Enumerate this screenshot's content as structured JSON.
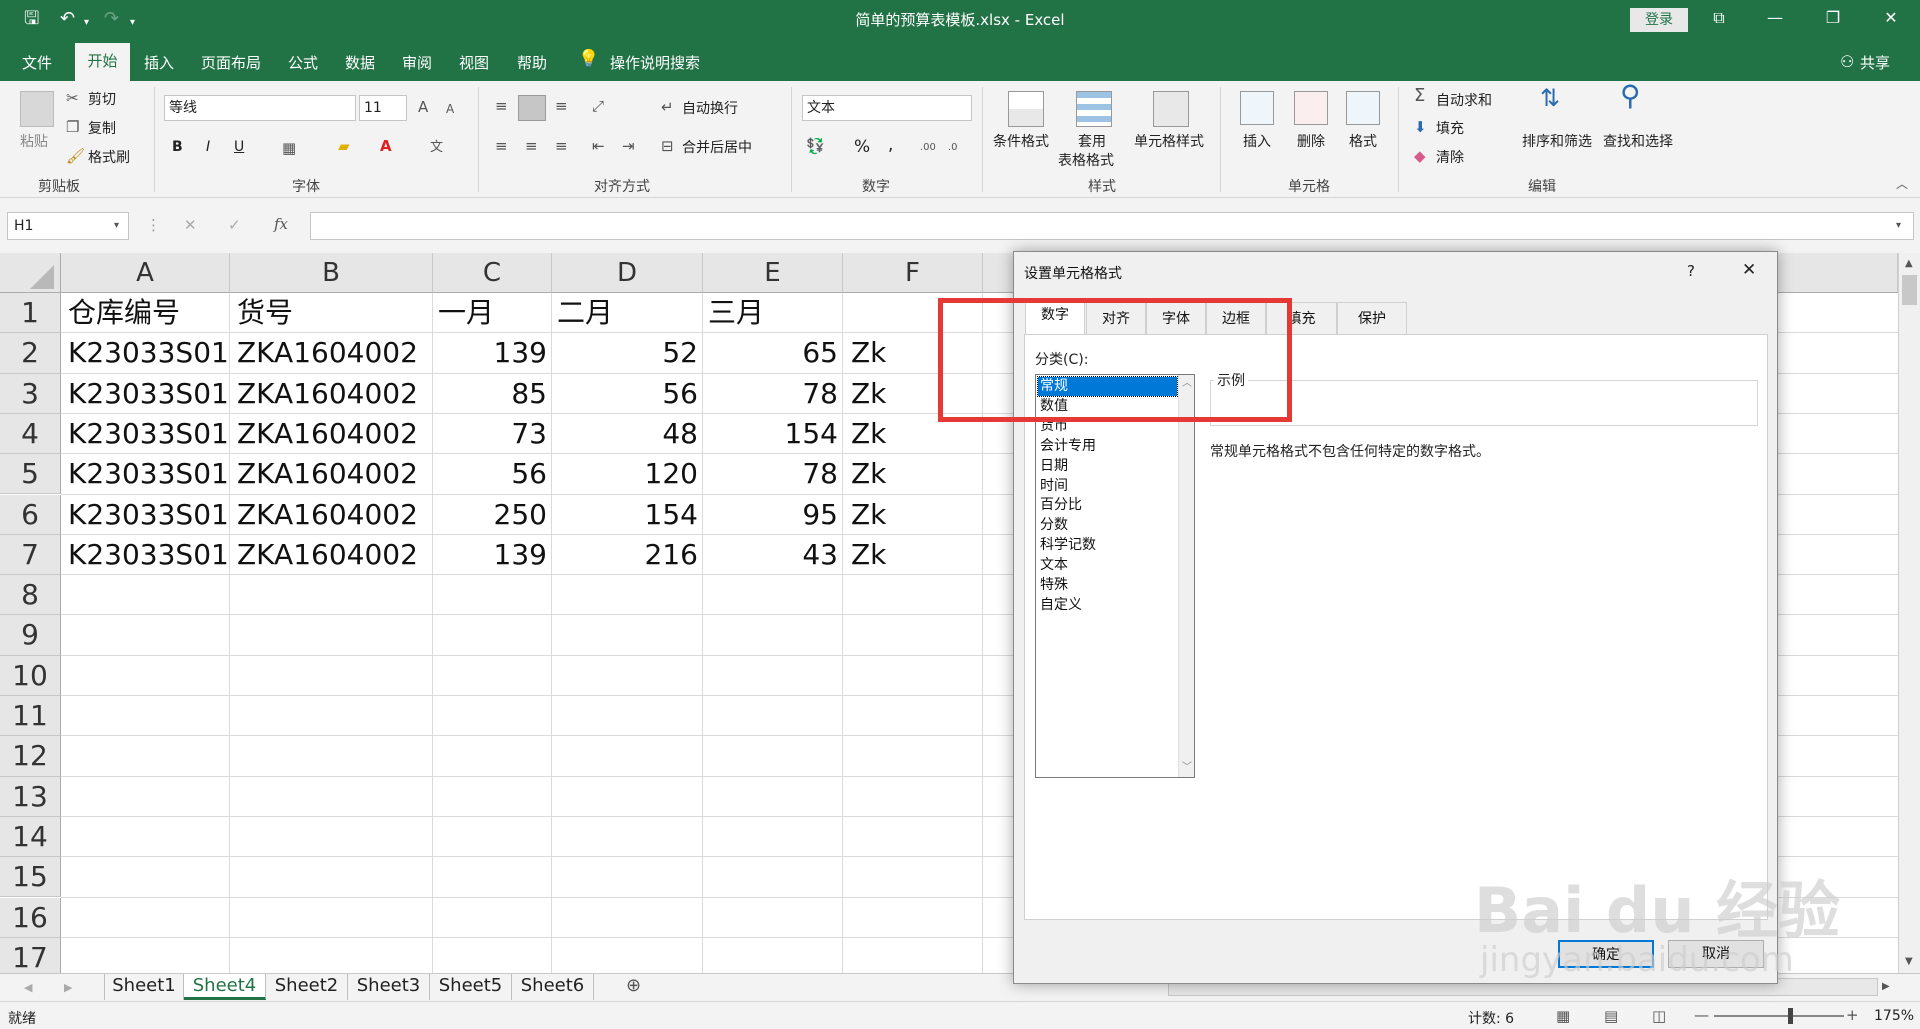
{
  "title_bar": {
    "doc_title": "简单的预算表模板.xlsx  -  Excel",
    "login": "登录"
  },
  "menu": {
    "tabs": [
      "文件",
      "开始",
      "插入",
      "页面布局",
      "公式",
      "数据",
      "审阅",
      "视图",
      "帮助"
    ],
    "tell_me": "操作说明搜索",
    "share": "共享"
  },
  "ribbon": {
    "clipboard": {
      "paste": "粘贴",
      "cut": "剪切",
      "copy": "复制",
      "format_painter": "格式刷",
      "label": "剪贴板"
    },
    "font": {
      "font_name": "等线",
      "font_size": "11",
      "bold": "B",
      "italic": "I",
      "underline": "U",
      "label": "字体"
    },
    "alignment": {
      "wrap_text": "自动换行",
      "merge_center": "合并后居中",
      "label": "对齐方式"
    },
    "number": {
      "format": "文本",
      "percent": "%",
      "comma": ",",
      "label": "数字"
    },
    "styles": {
      "conditional": "条件格式",
      "table_line1": "套用",
      "table_line2": "表格格式",
      "cell_styles": "单元格样式",
      "label": "样式"
    },
    "cells": {
      "insert": "插入",
      "delete": "删除",
      "format": "格式",
      "label": "单元格"
    },
    "editing": {
      "autosum": "自动求和",
      "fill": "填充",
      "clear": "清除",
      "sort": "排序和筛选",
      "find": "查找和选择",
      "label": "编辑"
    }
  },
  "formula_bar": {
    "name_box": "H1",
    "fx": "fx",
    "value": ""
  },
  "sheet": {
    "columns": [
      "A",
      "B",
      "C",
      "D",
      "E",
      "F"
    ],
    "row_numbers": [
      "1",
      "2",
      "3",
      "4",
      "5",
      "6",
      "7",
      "8",
      "9",
      "10",
      "11",
      "12",
      "13",
      "14",
      "15",
      "16",
      "17"
    ],
    "header_row": [
      "仓库编号",
      "货号",
      "一月",
      "二月",
      "三月"
    ],
    "rows": [
      [
        "K23033S01",
        "ZKA1604002",
        "139",
        "52",
        "65",
        "Zk"
      ],
      [
        "K23033S01",
        "ZKA1604002",
        "85",
        "56",
        "78",
        "Zk"
      ],
      [
        "K23033S01",
        "ZKA1604002",
        "73",
        "48",
        "154",
        "Zk"
      ],
      [
        "K23033S01",
        "ZKA1604002",
        "56",
        "120",
        "78",
        "Zk"
      ],
      [
        "K23033S01",
        "ZKA1604002",
        "250",
        "154",
        "95",
        "Zk"
      ],
      [
        "K23033S01",
        "ZKA1604002",
        "139",
        "216",
        "43",
        "Zk"
      ]
    ]
  },
  "sheet_tabs": [
    "Sheet1",
    "Sheet4",
    "Sheet2",
    "Sheet3",
    "Sheet5",
    "Sheet6"
  ],
  "active_sheet": "Sheet4",
  "status": {
    "ready": "就绪",
    "count": "计数: 6",
    "zoom": "175%"
  },
  "dialog": {
    "title": "设置单元格格式",
    "help": "?",
    "close": "✕",
    "tabs": [
      "数字",
      "对齐",
      "字体",
      "边框",
      "填充",
      "保护"
    ],
    "category_label": "分类(C):",
    "categories": [
      "常规",
      "数值",
      "货币",
      "会计专用",
      "日期",
      "时间",
      "百分比",
      "分数",
      "科学记数",
      "文本",
      "特殊",
      "自定义"
    ],
    "selected_category": "常规",
    "sample_label": "示例",
    "description": "常规单元格格式不包含任何特定的数字格式。",
    "ok": "确定",
    "cancel": "取消"
  },
  "watermark": {
    "brand": "Bai du 经验",
    "url": "jingyan.baidu.com"
  },
  "colors": {
    "excel_green": "#217346",
    "highlight_red": "#e53935",
    "selection_blue": "#0078d7"
  }
}
